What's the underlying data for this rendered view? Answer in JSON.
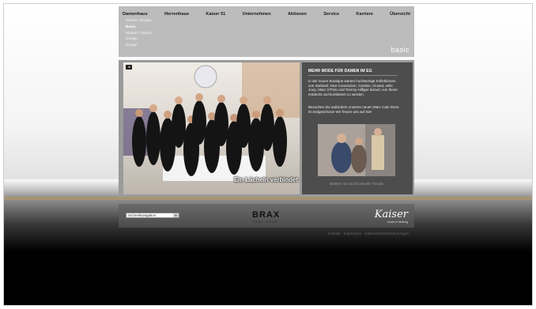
{
  "nav": {
    "items": [
      "Damenhaus",
      "Herrenhaus",
      "Kaiser 51",
      "Unternehmen",
      "Aktionen",
      "Service",
      "Karriere",
      "Übersicht"
    ]
  },
  "subnav": {
    "items": [
      "Modern Design",
      "Basic",
      "Modern Classic",
      "Design",
      "Design"
    ]
  },
  "brand": {
    "basic": "basic"
  },
  "photo": {
    "caption": "Ein Lächeln verbindet"
  },
  "panel": {
    "title": "MEHR MODE FÜR DAMEN IM EG",
    "paragraph1": "In der neuen Boutique warten hochwertige Kollektionen von Stefanel, Nice Connection, Cambio, Closed, velle Joop, Marc O'Polo und Tommy Hilfiger darauf, von Ihnen entdeckt und kombiniert zu werden.",
    "paragraph2": "Besuchen Sie außerdem unseren neuen Marc Cain Store im Erdgeschoss! Wir freuen uns auf Sie!",
    "image_caption": "Blättern Sie durch aktuelle Trends"
  },
  "footer": {
    "quicknav": "Schnellnavigation",
    "brax": "BRAX",
    "brax_sub": "FEEL GOOD",
    "kaiser": "Kaiser",
    "kaiser_sub": "mode in freiburg",
    "links": [
      "Kontakt",
      "Impressum",
      "Datenschutzbestimmungen"
    ]
  },
  "colors": {
    "nav_bg": "#bcbcbc",
    "panel_bg": "#4d4d4d",
    "accent_stripe": "#a69472"
  },
  "icons": {
    "prev": "arrow-left-icon",
    "dropdown": "chevron-down-icon"
  }
}
